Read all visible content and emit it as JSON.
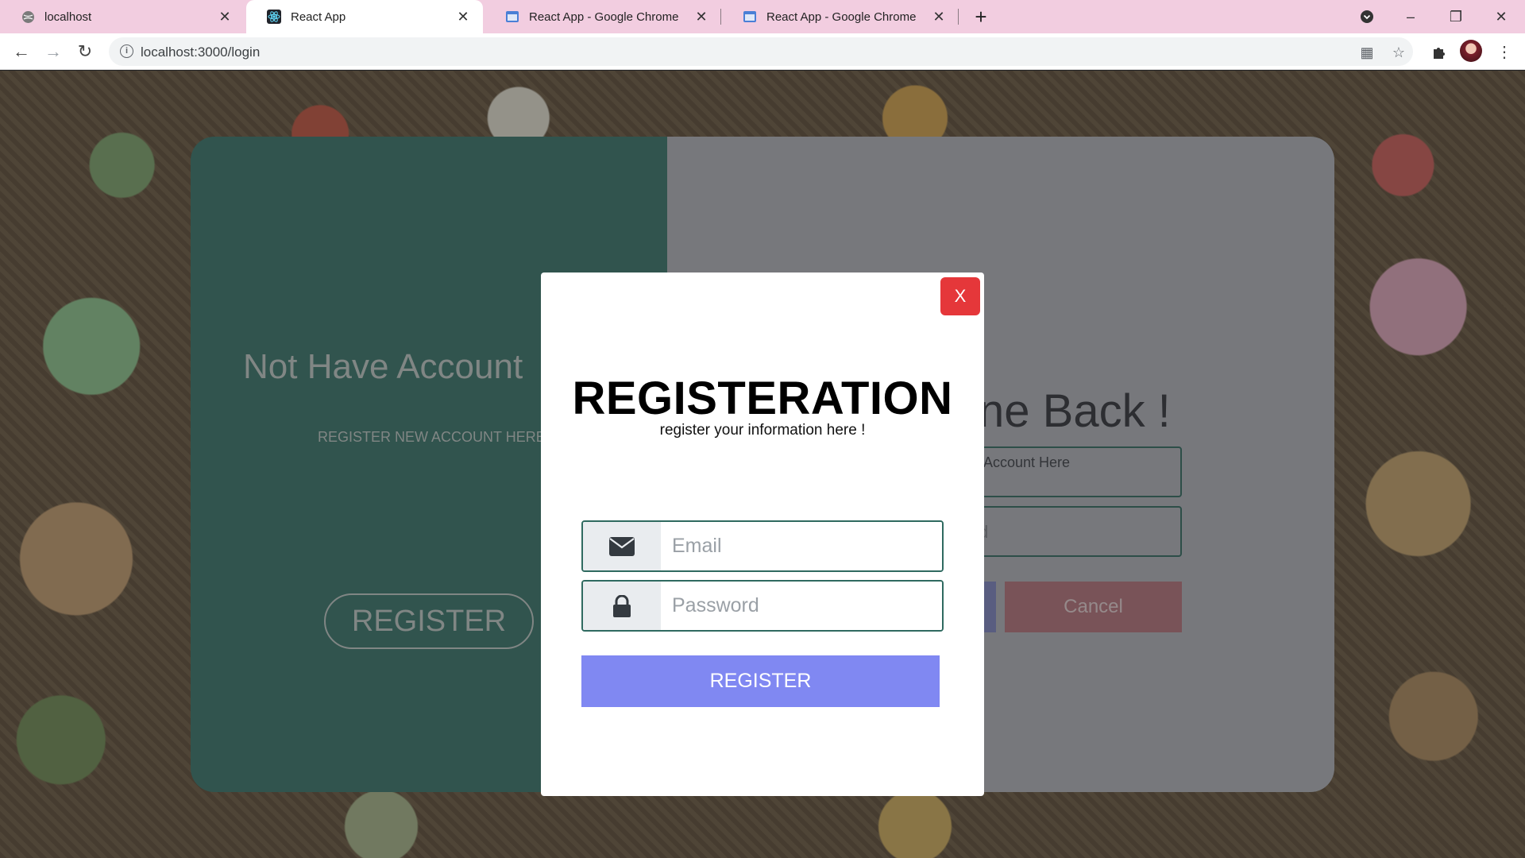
{
  "browser": {
    "tabs": [
      {
        "title": "localhost",
        "active": false
      },
      {
        "title": "React App",
        "active": true
      },
      {
        "title": "React App - Google Chrome",
        "active": false
      },
      {
        "title": "React App - Google Chrome",
        "active": false
      }
    ],
    "new_tab": "+",
    "url": "localhost:3000/login",
    "window_controls": {
      "minimize": "–",
      "maximize": "❐",
      "close": "✕"
    }
  },
  "background_page": {
    "left_panel": {
      "title": "Not Have Account",
      "subtitle": "REGISTER NEW ACCOUNT HERE",
      "register_label": "REGISTER"
    },
    "right_panel": {
      "title": "ne Back !",
      "subtitle": "r Account Here",
      "password_placeholder_fragment": "d",
      "cancel_label": "Cancel"
    }
  },
  "modal": {
    "close_label": "X",
    "title": "REGISTERATION",
    "subtitle": "register your information here !",
    "email_placeholder": "Email",
    "password_placeholder": "Password",
    "register_label": "REGISTER",
    "colors": {
      "register": "#8088f2",
      "close": "#e5373a",
      "field_border": "#2f6a60"
    }
  },
  "theme": {
    "left_panel": "#35756b",
    "right_panel": "#b4b7be",
    "tabbar": "#f2cde0"
  }
}
